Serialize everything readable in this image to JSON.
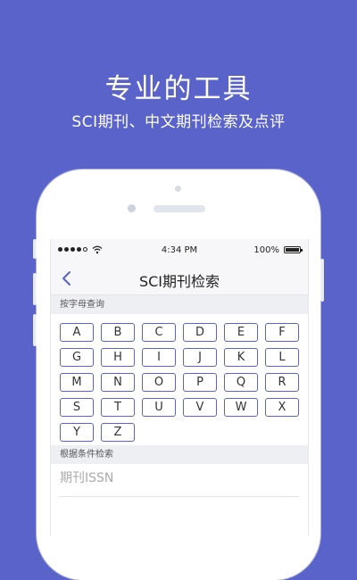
{
  "banner": {
    "headline": "专业的工具",
    "subline": "SCI期刊、中文期刊检索及点评"
  },
  "status_bar": {
    "time": "4:34 PM",
    "battery": "100%"
  },
  "nav": {
    "title": "SCI期刊检索"
  },
  "letter_section": {
    "label": "按字母查询",
    "letters": [
      "A",
      "B",
      "C",
      "D",
      "E",
      "F",
      "G",
      "H",
      "I",
      "J",
      "K",
      "L",
      "M",
      "N",
      "O",
      "P",
      "Q",
      "R",
      "S",
      "T",
      "U",
      "V",
      "W",
      "X",
      "Y",
      "Z"
    ]
  },
  "condition_section": {
    "label": "根据条件检索",
    "issn_placeholder": "期刊ISSN"
  },
  "colors": {
    "background": "#5a63c9",
    "accent": "#5a63c9"
  }
}
